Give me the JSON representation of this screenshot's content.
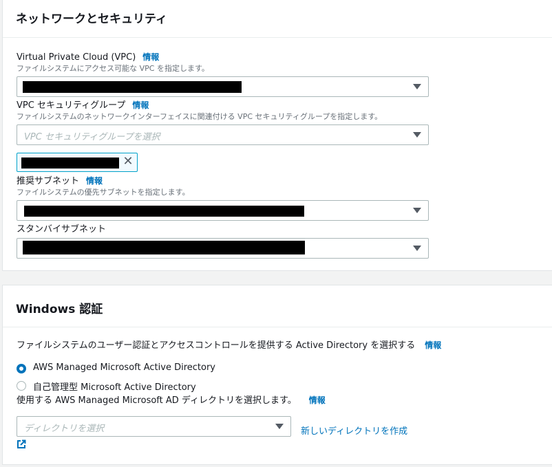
{
  "network": {
    "title": "ネットワークとセキュリティ",
    "vpc": {
      "label": "Virtual Private Cloud (VPC)",
      "info": "情報",
      "description": "ファイルシステムにアクセス可能な VPC を指定します。"
    },
    "security_group": {
      "label": "VPC セキュリティグループ",
      "info": "情報",
      "description": "ファイルシステムのネットワークインターフェイスに関連付ける VPC セキュリティグループを指定します。",
      "placeholder": "VPC セキュリティグループを選択"
    },
    "preferred_subnet": {
      "label": "推奨サブネット",
      "info": "情報",
      "description": "ファイルシステムの優先サブネットを指定します。"
    },
    "standby_subnet": {
      "label": "スタンバイサブネット"
    }
  },
  "windows_auth": {
    "title": "Windows 認証",
    "intro": "ファイルシステムのユーザー認証とアクセスコントロールを提供する Active Directory を選択する",
    "intro_info": "情報",
    "options": [
      {
        "label": "AWS Managed Microsoft Active Directory",
        "selected": true
      },
      {
        "label": "自己管理型 Microsoft Active Directory",
        "selected": false
      }
    ],
    "directory": {
      "description": "使用する AWS Managed Microsoft AD ディレクトリを選択します。",
      "info": "情報",
      "placeholder": "ディレクトリを選択",
      "create_link": "新しいディレクトリを作成"
    }
  },
  "icons": {
    "dropdown": "caret-down-icon",
    "remove": "close-icon",
    "external": "external-link-icon"
  },
  "colors": {
    "link": "#0073bb",
    "radio_selected": "#0073bb",
    "token_border": "#00a1c9"
  }
}
